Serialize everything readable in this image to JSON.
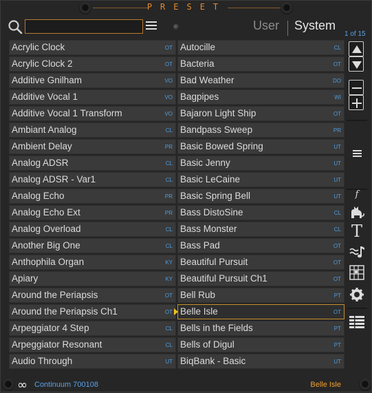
{
  "header": {
    "title": "PRESET"
  },
  "search": {
    "value": "",
    "placeholder": ""
  },
  "tabs": {
    "user": "User",
    "system": "System"
  },
  "page_indicator": "1 of 15",
  "presets_left": [
    {
      "name": "Acrylic Clock",
      "category": "OT"
    },
    {
      "name": "Acrylic Clock 2",
      "category": "OT"
    },
    {
      "name": "Additive Gnilham",
      "category": "VO"
    },
    {
      "name": "Additive Vocal 1",
      "category": "VO"
    },
    {
      "name": "Additive Vocal 1 Transform",
      "category": "VO"
    },
    {
      "name": "Ambiant Analog",
      "category": "CL"
    },
    {
      "name": "Ambient Delay",
      "category": "PR"
    },
    {
      "name": "Analog ADSR",
      "category": "CL"
    },
    {
      "name": "Analog ADSR - Var1",
      "category": "CL"
    },
    {
      "name": "Analog Echo",
      "category": "PR"
    },
    {
      "name": "Analog Echo Ext",
      "category": "PR"
    },
    {
      "name": "Analog Overload",
      "category": "CL"
    },
    {
      "name": "Another Big One",
      "category": "CL"
    },
    {
      "name": "Anthophila Organ",
      "category": "KY"
    },
    {
      "name": "Apiary",
      "category": "KY"
    },
    {
      "name": "Around the Periapsis",
      "category": "OT"
    },
    {
      "name": "Around the Periapsis Ch1",
      "category": "OT"
    },
    {
      "name": "Arpeggiator 4 Step",
      "category": "CL"
    },
    {
      "name": "Arpeggiator Resonant",
      "category": "CL"
    },
    {
      "name": "Audio Through",
      "category": "UT"
    }
  ],
  "presets_right": [
    {
      "name": "Autocille",
      "category": "CL"
    },
    {
      "name": "Bacteria",
      "category": "OT"
    },
    {
      "name": "Bad Weather",
      "category": "DO"
    },
    {
      "name": "Bagpipes",
      "category": "WI"
    },
    {
      "name": "Bajaron Light Ship",
      "category": "OT"
    },
    {
      "name": "Bandpass Sweep",
      "category": "PR"
    },
    {
      "name": "Basic Bowed Spring",
      "category": "UT"
    },
    {
      "name": "Basic Jenny",
      "category": "UT"
    },
    {
      "name": "Basic LeCaine",
      "category": "UT"
    },
    {
      "name": "Basic Spring Bell",
      "category": "UT"
    },
    {
      "name": "Bass DistoSine",
      "category": "CL"
    },
    {
      "name": "Bass Monster",
      "category": "CL"
    },
    {
      "name": "Bass Pad",
      "category": "OT"
    },
    {
      "name": "Beautiful Pursuit",
      "category": "OT"
    },
    {
      "name": "Beautiful Pursuit Ch1",
      "category": "OT"
    },
    {
      "name": "Bell Rub",
      "category": "PT"
    },
    {
      "name": "Belle Isle",
      "category": "OT",
      "selected": true
    },
    {
      "name": "Bells in the Fields",
      "category": "PT"
    },
    {
      "name": "Bells of Digul",
      "category": "PT"
    },
    {
      "name": "BiqBank - Basic",
      "category": "UT"
    }
  ],
  "sidebar": {
    "icons": [
      "arrow-up-icon",
      "arrow-down-icon",
      "minus-icon",
      "plus-icon",
      "list-menu-icon",
      "function-icon",
      "cat-icon",
      "text-icon",
      "wave-note-icon",
      "keyboard-grid-icon",
      "gear-icon",
      "list-view-icon"
    ],
    "function_glyph": "f",
    "text_glyph": "T"
  },
  "footer": {
    "infinity_glyph": "∞",
    "device": "Continuum 700108",
    "current_preset": "Belle Isle"
  },
  "colors": {
    "accent": "#e58a2e",
    "category": "#4f9de0",
    "selection": "#c8902e",
    "arrow": "#f0c020"
  }
}
